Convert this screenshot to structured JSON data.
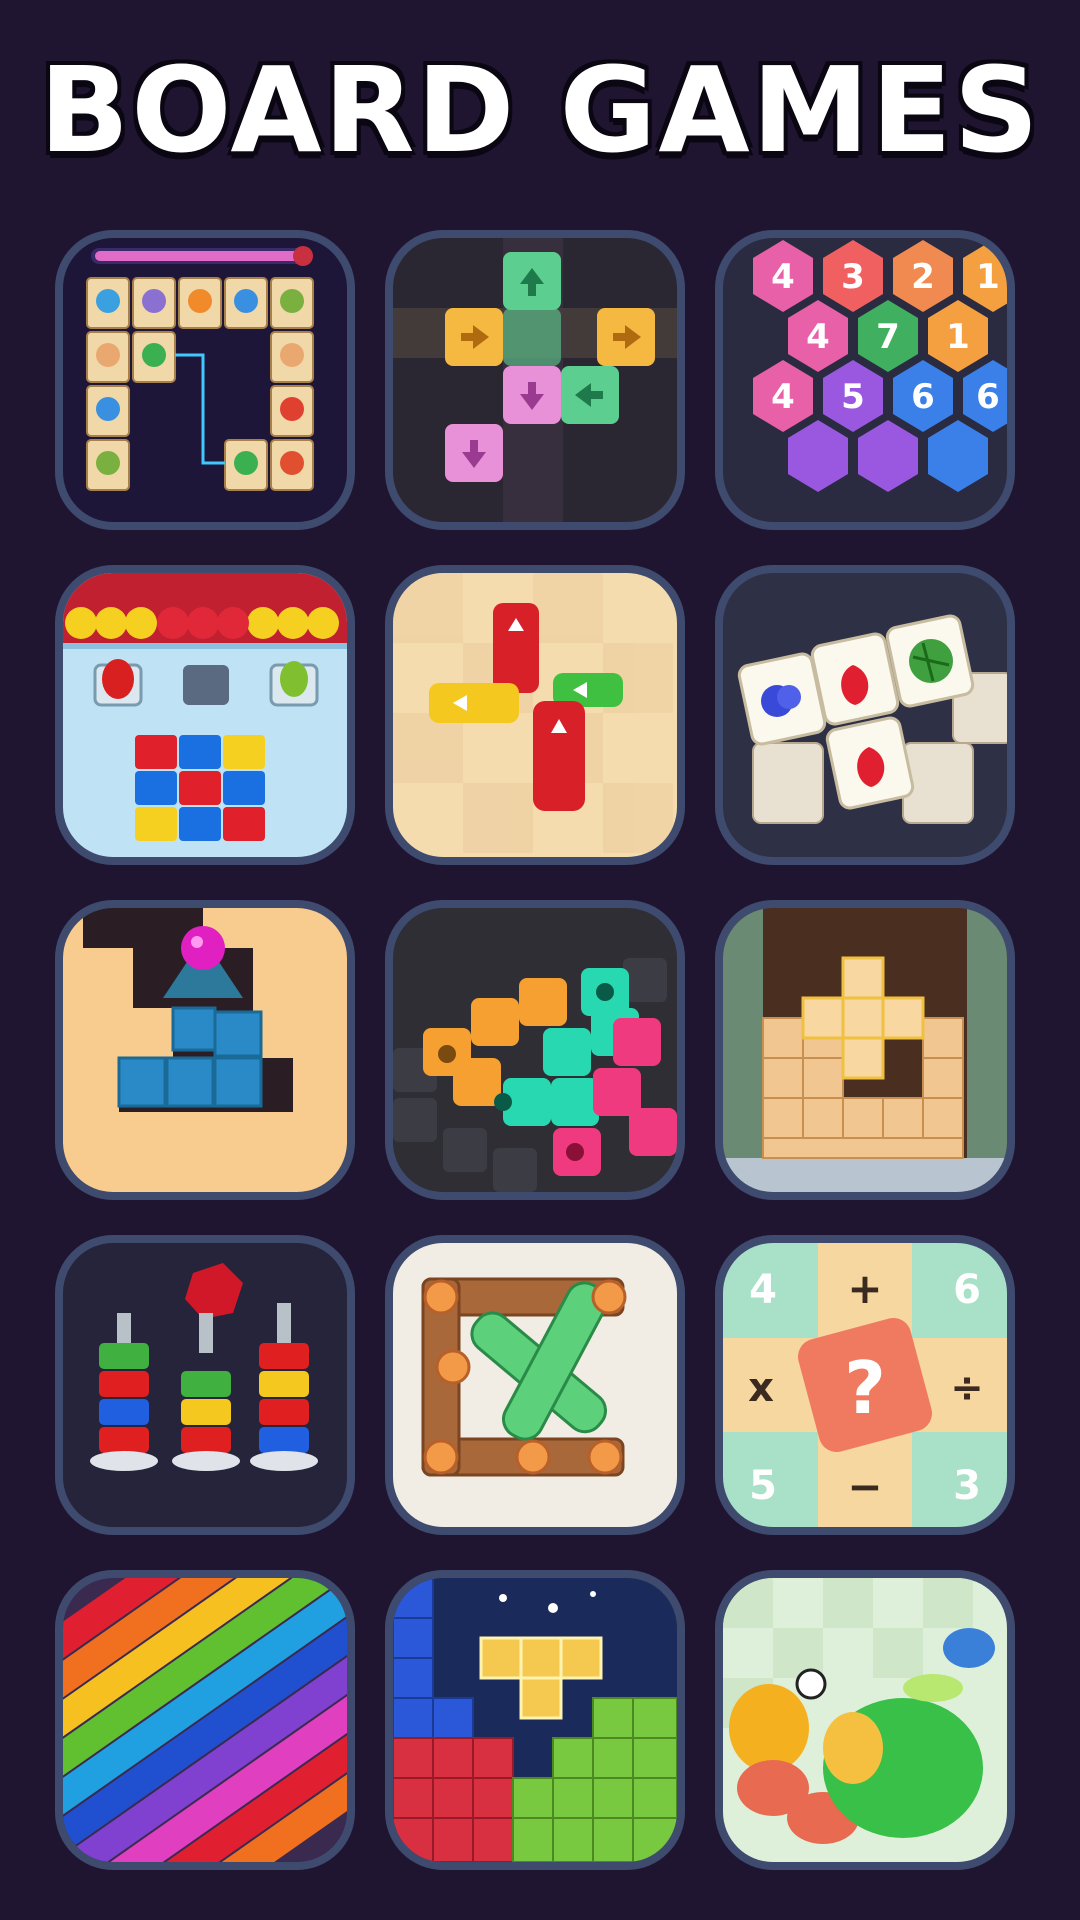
{
  "header": {
    "title": "BOARD GAMES"
  },
  "games": [
    {
      "icon": "onet-connect-icon"
    },
    {
      "icon": "arrow-blocks-icon"
    },
    {
      "icon": "hexa-number-merge-icon"
    },
    {
      "icon": "color-sort-shooter-icon"
    },
    {
      "icon": "bus-jam-icon"
    },
    {
      "icon": "tile-match-icon"
    },
    {
      "icon": "ball-maze-icon"
    },
    {
      "icon": "pipe-connect-icon"
    },
    {
      "icon": "wood-block-puzzle-icon"
    },
    {
      "icon": "nut-sort-icon"
    },
    {
      "icon": "wood-screw-icon"
    },
    {
      "icon": "math-puzzle-icon"
    },
    {
      "icon": "rainbow-jam-icon"
    },
    {
      "icon": "block-puzzle-icon"
    },
    {
      "icon": "merge-animals-icon"
    }
  ],
  "math_puzzle": {
    "top_left": "4",
    "top_right": "6",
    "left": "x",
    "right": "÷",
    "bottom_left": "5",
    "bottom_right": "3",
    "top": "+",
    "bottom": "−",
    "center": "?"
  },
  "hexa": {
    "row1": [
      "4",
      "3",
      "2",
      "1"
    ],
    "row2": [
      "4",
      "7",
      "1"
    ],
    "row3": [
      "4",
      "5",
      "6",
      "6"
    ]
  },
  "colors": {
    "background": "#1f1530",
    "tile_border": "#3e4b6e"
  }
}
